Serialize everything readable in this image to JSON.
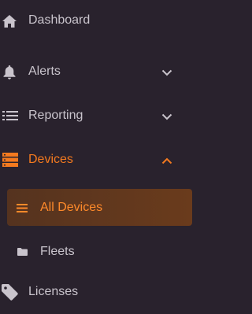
{
  "nav": {
    "items": [
      {
        "label": "Dashboard",
        "icon": "home-icon"
      },
      {
        "label": "Alerts",
        "icon": "bell-icon",
        "chevron": "chevron-down-icon"
      },
      {
        "label": "Reporting",
        "icon": "list-icon",
        "chevron": "chevron-down-icon"
      },
      {
        "label": "Devices",
        "icon": "server-icon",
        "chevron": "chevron-up-icon",
        "active": true
      },
      {
        "label": "Licenses",
        "icon": "tag-icon"
      }
    ],
    "devices_sub": [
      {
        "label": "All Devices",
        "icon": "menu-lines-icon",
        "active": true
      },
      {
        "label": "Fleets",
        "icon": "folder-icon"
      }
    ]
  },
  "colors": {
    "background": "#29222d",
    "text": "#c9c4cc",
    "accent": "#f47a1f",
    "active_bg": "#5e3720"
  }
}
